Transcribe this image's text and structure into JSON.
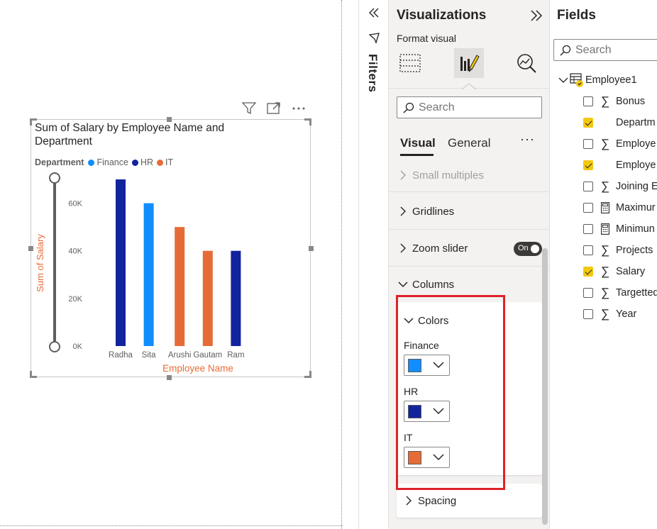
{
  "visual_header": {
    "filter_icon": "filter-icon",
    "focus_icon": "focus-mode-icon",
    "more_icon": "more-options-icon"
  },
  "chart_data": {
    "type": "bar",
    "title": "Sum of Salary by Employee Name and Department",
    "xlabel": "Employee Name",
    "ylabel": "Sum of Salary",
    "legend_title": "Department",
    "legend_position": "top-left",
    "categories": [
      "Radha",
      "Sita",
      "Arushi",
      "Gautam",
      "Ram"
    ],
    "series": [
      {
        "name": "Finance",
        "color": "#118dff",
        "values": [
          null,
          60000,
          null,
          null,
          null
        ]
      },
      {
        "name": "HR",
        "color": "#12239e",
        "values": [
          70000,
          null,
          null,
          null,
          40000
        ]
      },
      {
        "name": "IT",
        "color": "#e66c37",
        "values": [
          null,
          null,
          50000,
          40000,
          null
        ]
      }
    ],
    "bar_colors": [
      "#12239e",
      "#118dff",
      "#e66c37",
      "#e66c37",
      "#12239e"
    ],
    "values": [
      70000,
      60000,
      50000,
      40000,
      40000
    ],
    "yticks": [
      0,
      20000,
      40000,
      60000
    ],
    "ytick_labels": [
      "0K",
      "20K",
      "40K",
      "60K"
    ],
    "ylim": [
      0,
      70000
    ],
    "grid": false,
    "zoom_slider": true
  },
  "filters": {
    "label": "Filters",
    "collapse_icon": "double-chevron-left-icon",
    "funnel_icon": "filter-icon"
  },
  "visualizations": {
    "title": "Visualizations",
    "expand_icon": "double-chevron-right-icon",
    "format_visual_label": "Format visual",
    "tabs_icons": [
      "build-visual-icon",
      "format-visual-icon",
      "analytics-icon"
    ],
    "search_placeholder": "Search",
    "tabs": {
      "visual": "Visual",
      "general": "General",
      "more": "···"
    },
    "sections": {
      "small_multiples": "Small multiples",
      "gridlines": "Gridlines",
      "zoom_slider": "Zoom slider",
      "zoom_state": "On",
      "columns": "Columns",
      "colors": "Colors",
      "spacing": "Spacing"
    },
    "colors": [
      {
        "label": "Finance",
        "value": "#118dff"
      },
      {
        "label": "HR",
        "value": "#12239e"
      },
      {
        "label": "IT",
        "value": "#e66c37"
      }
    ]
  },
  "fields": {
    "title": "Fields",
    "search_placeholder": "Search",
    "table_name": "Employee1",
    "items": [
      {
        "label": "Bonus",
        "checked": false,
        "icon": "sigma"
      },
      {
        "label": "Departm",
        "checked": true,
        "icon": "none"
      },
      {
        "label": "Employe",
        "checked": false,
        "icon": "sigma"
      },
      {
        "label": "Employe",
        "checked": true,
        "icon": "none"
      },
      {
        "label": "Joining E",
        "checked": false,
        "icon": "sigma"
      },
      {
        "label": "Maximur",
        "checked": false,
        "icon": "calc"
      },
      {
        "label": "Minimun",
        "checked": false,
        "icon": "calc"
      },
      {
        "label": "Projects",
        "checked": false,
        "icon": "sigma"
      },
      {
        "label": "Salary",
        "checked": true,
        "icon": "sigma"
      },
      {
        "label": "Targetted",
        "checked": false,
        "icon": "sigma"
      },
      {
        "label": "Year",
        "checked": false,
        "icon": "sigma"
      }
    ]
  }
}
